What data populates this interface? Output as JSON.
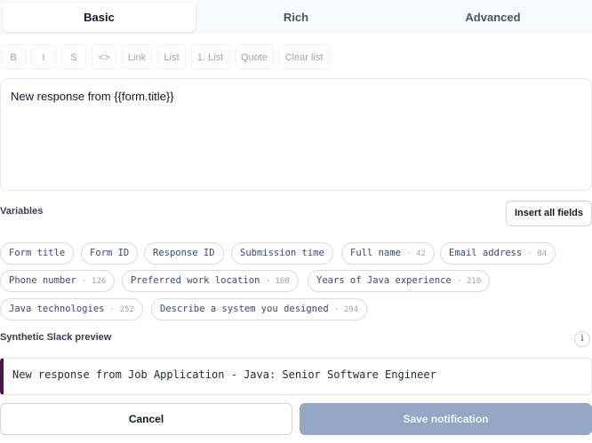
{
  "tabs": [
    {
      "label": "Basic",
      "active": true
    },
    {
      "label": "Rich",
      "active": false
    },
    {
      "label": "Advanced",
      "active": false
    }
  ],
  "toolbar": [
    "B",
    "I",
    "S",
    "<>",
    "Link",
    "List",
    "1. List",
    "Quote",
    "Clear list"
  ],
  "editor": {
    "value": "New response from {{form.title}}"
  },
  "variables": {
    "label": "Variables",
    "insert_all_label": "Insert all fields",
    "chips": [
      {
        "label": "Form title",
        "num": ""
      },
      {
        "label": "Form ID",
        "num": ""
      },
      {
        "label": "Response ID",
        "num": ""
      },
      {
        "label": "Submission time",
        "num": ""
      },
      {
        "label": "Full name",
        "num": "· 42"
      },
      {
        "label": "Email address",
        "num": "· 84"
      },
      {
        "label": "Phone number",
        "num": "· 126"
      },
      {
        "label": "Preferred work location",
        "num": "· 168"
      },
      {
        "label": "Years of Java experience",
        "num": "· 210"
      },
      {
        "label": "Java technologies",
        "num": "· 252"
      },
      {
        "label": "Describe a system you designed",
        "num": "· 294"
      }
    ]
  },
  "preview": {
    "label": "Synthetic Slack preview",
    "info_icon": "i",
    "text": "New response from Job Application - Java: Senior Software Engineer",
    "accent_color": "#4a154b"
  },
  "footer": {
    "cancel_label": "Cancel",
    "save_label": "Save notification"
  },
  "colors": {
    "save_disabled": "#94a8c5",
    "chip_text": "#3b4a6b"
  }
}
